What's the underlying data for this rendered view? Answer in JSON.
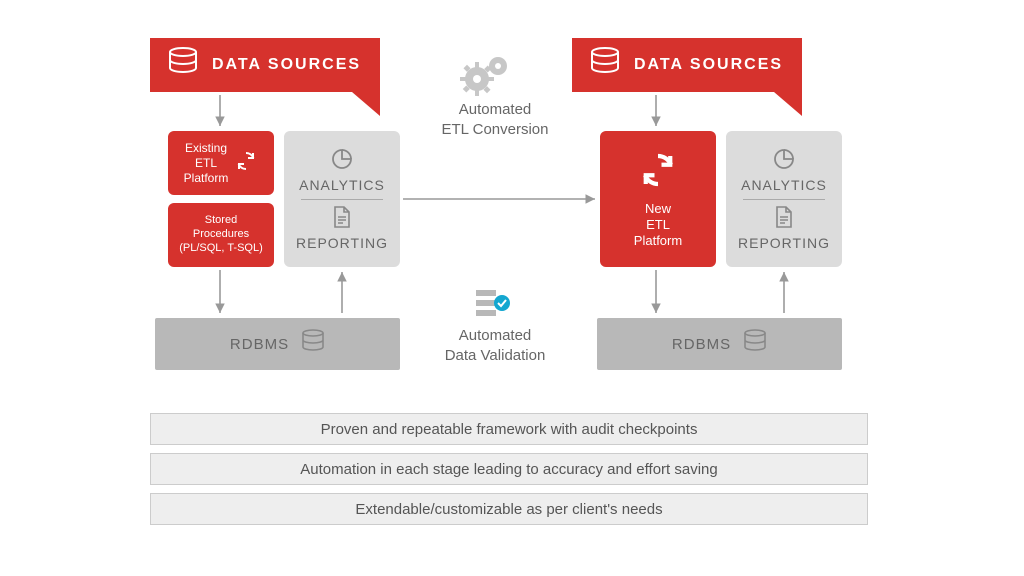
{
  "left": {
    "flag_title": "DATA SOURCES",
    "etl_box": "Existing\nETL\nPlatform",
    "sp_box": "Stored\nProcedures\n(PL/SQL, T-SQL)",
    "analytics": "ANALYTICS",
    "reporting": "REPORTING",
    "rdbms": "RDBMS"
  },
  "right": {
    "flag_title": "DATA SOURCES",
    "etl_box": "New\nETL\nPlatform",
    "analytics": "ANALYTICS",
    "reporting": "REPORTING",
    "rdbms": "RDBMS"
  },
  "center": {
    "top_note": "Automated\nETL Conversion",
    "bottom_note": "Automated\nData Validation"
  },
  "bars": [
    "Proven and repeatable framework with audit checkpoints",
    "Automation in each stage leading to accuracy and effort saving",
    "Extendable/customizable as per client's needs"
  ],
  "colors": {
    "brand": "#d6322d",
    "grey": "#b8b8b8",
    "lightgrey": "#dcdcdc"
  }
}
